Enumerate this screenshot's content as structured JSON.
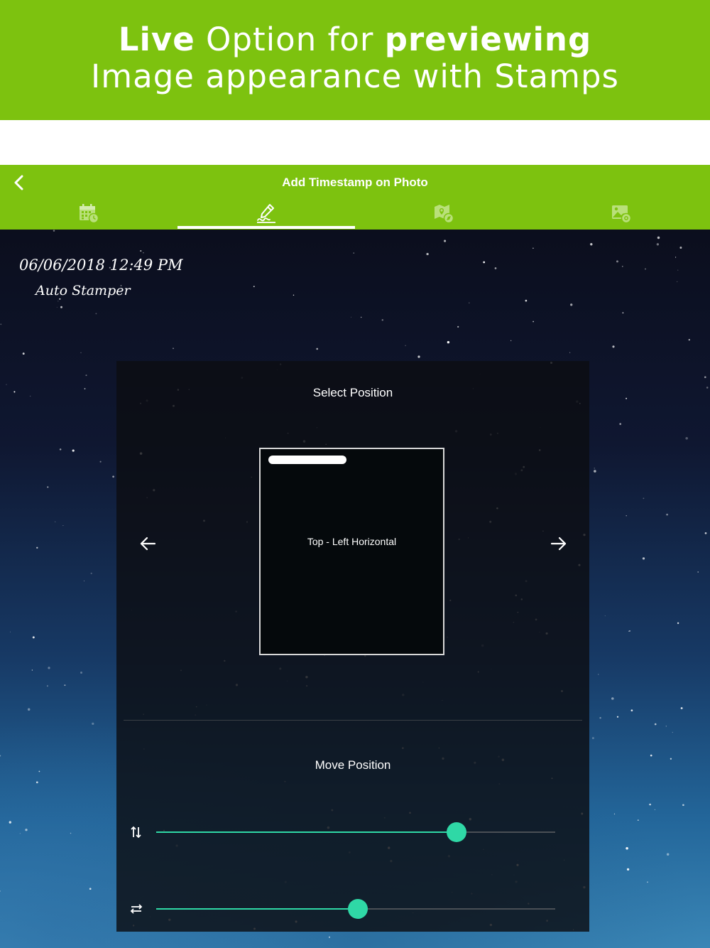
{
  "promo": {
    "line1_bold_a": "Live",
    "line1_regular": " Option for ",
    "line1_bold_b": "previewing",
    "line2": "Image appearance with Stamps",
    "background": "#7dc20f"
  },
  "appbar": {
    "title": "Add Timestamp on Photo",
    "back_icon": "chevron-left-icon",
    "tabs": [
      {
        "icon": "calendar-clock-icon",
        "selected": false
      },
      {
        "icon": "signature-pen-icon",
        "selected": true
      },
      {
        "icon": "map-location-icon",
        "selected": false
      },
      {
        "icon": "image-settings-icon",
        "selected": false
      }
    ],
    "accent": "#7dc20f"
  },
  "stamp": {
    "date": "06/06/2018 12:49 PM",
    "text": "Auto Stamper"
  },
  "position_panel": {
    "title": "Select Position",
    "selected_position": "Top - Left Horizontal",
    "prev_icon": "arrow-left-icon",
    "next_icon": "arrow-right-icon"
  },
  "move_panel": {
    "title": "Move Position",
    "sliders": [
      {
        "icon": "vertical-swap-icon",
        "value": 0.753
      },
      {
        "icon": "horizontal-swap-icon",
        "value": 0.506
      }
    ],
    "accent": "#2fd8a6"
  }
}
